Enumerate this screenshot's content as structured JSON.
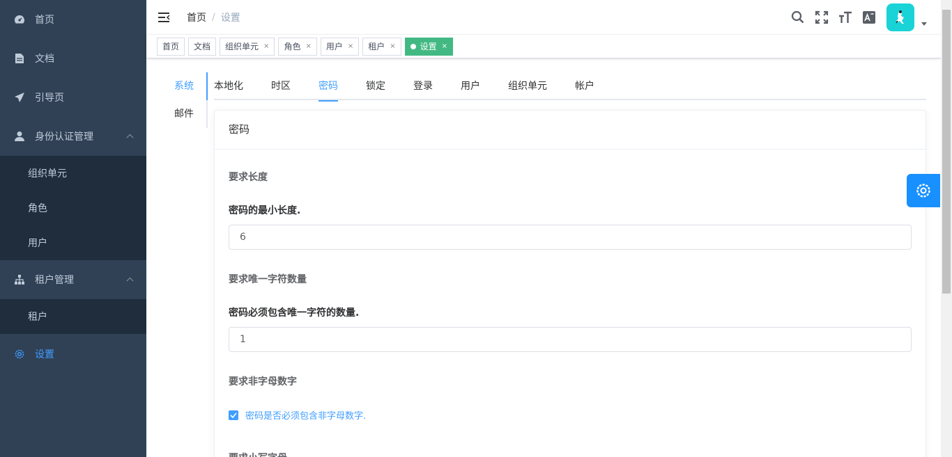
{
  "sidebar": {
    "items": [
      {
        "label": "首页",
        "icon": "dashboard-icon"
      },
      {
        "label": "文档",
        "icon": "document-icon"
      },
      {
        "label": "引导页",
        "icon": "paper-plane-icon"
      },
      {
        "label": "身份认证管理",
        "icon": "user-icon",
        "expanded": true,
        "children": [
          {
            "label": "组织单元"
          },
          {
            "label": "角色"
          },
          {
            "label": "用户"
          }
        ]
      },
      {
        "label": "租户管理",
        "icon": "tree-icon",
        "expanded": true,
        "children": [
          {
            "label": "租户"
          }
        ]
      },
      {
        "label": "设置",
        "icon": "gear-icon",
        "active": true
      }
    ]
  },
  "breadcrumb": {
    "home": "首页",
    "current": "设置"
  },
  "tags": [
    {
      "label": "首页",
      "closable": false
    },
    {
      "label": "文档",
      "closable": false
    },
    {
      "label": "组织单元",
      "closable": true
    },
    {
      "label": "角色",
      "closable": true
    },
    {
      "label": "用户",
      "closable": true
    },
    {
      "label": "租户",
      "closable": true
    },
    {
      "label": "设置",
      "closable": true,
      "active": true
    }
  ],
  "tag_close_symbol": "×",
  "vtabs": [
    "系统",
    "邮件"
  ],
  "htabs": [
    "本地化",
    "时区",
    "密码",
    "锁定",
    "登录",
    "用户",
    "组织单元",
    "帐户"
  ],
  "card": {
    "title": "密码",
    "required_length_title": "要求长度",
    "min_length_label": "密码的最小长度.",
    "min_length_value": "6",
    "unique_chars_title": "要求唯一字符数量",
    "unique_chars_label": "密码必须包含唯一字符的数量.",
    "unique_chars_value": "1",
    "non_alnum_title": "要求非字母数字",
    "non_alnum_checkbox": "密码是否必须包含非字母数字.",
    "lowercase_title": "要求小写字母"
  },
  "colors": {
    "sidebar_bg": "#304156",
    "submenu_bg": "#1f2d3d",
    "accent": "#409eff",
    "active_tag": "#42b983",
    "avatar_bg": "#19d3d6"
  }
}
